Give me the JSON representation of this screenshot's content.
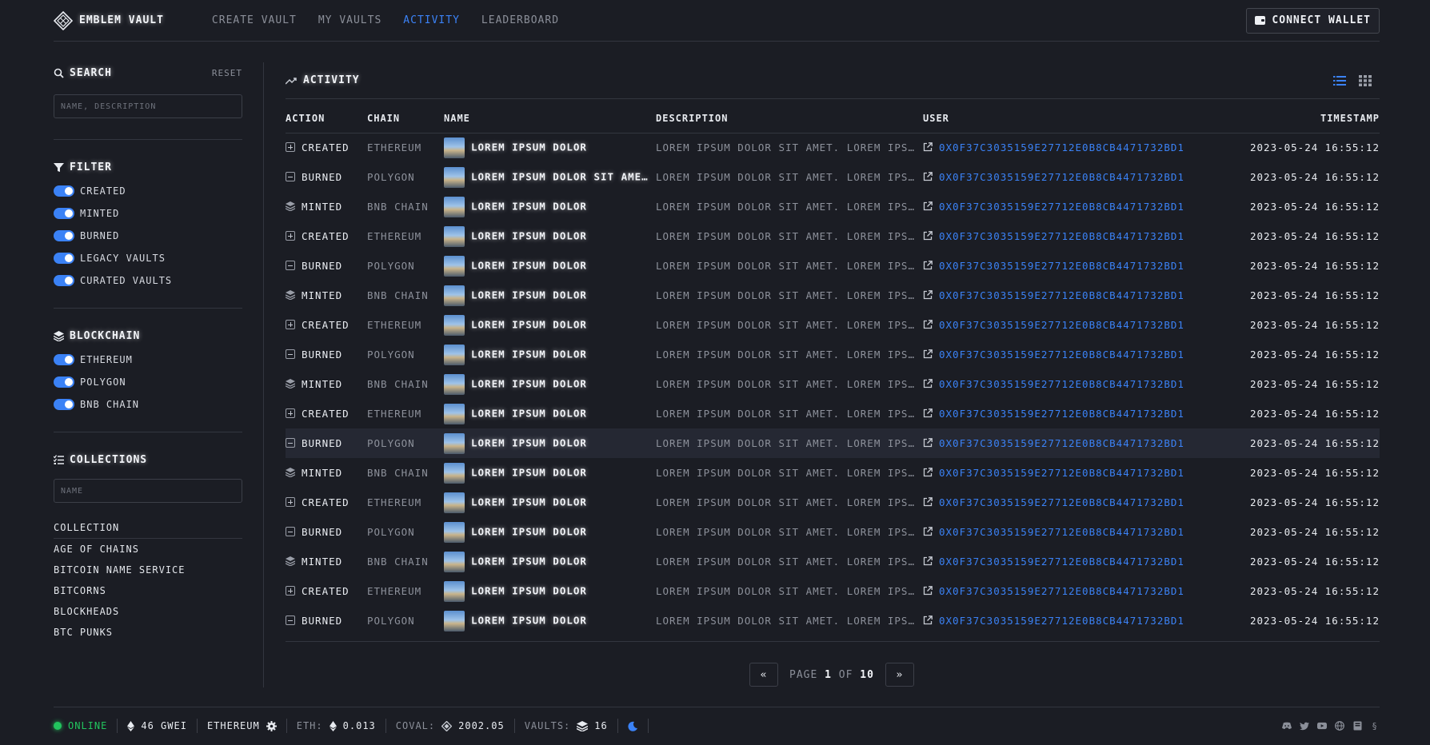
{
  "header": {
    "brand": "Emblem Vault",
    "nav": [
      {
        "label": "Create Vault",
        "active": false
      },
      {
        "label": "My Vaults",
        "active": false
      },
      {
        "label": "Activity",
        "active": true
      },
      {
        "label": "Leaderboard",
        "active": false
      }
    ],
    "connect_wallet": "Connect Wallet"
  },
  "sidebar": {
    "search": {
      "title": "Search",
      "reset": "Reset",
      "placeholder": "Name, Description"
    },
    "filter": {
      "title": "Filter",
      "items": [
        "Created",
        "Minted",
        "Burned",
        "Legacy Vaults",
        "Curated Vaults"
      ]
    },
    "blockchain": {
      "title": "Blockchain",
      "items": [
        "Ethereum",
        "Polygon",
        "BNB Chain"
      ]
    },
    "collections": {
      "title": "Collections",
      "placeholder": "Name",
      "header": "Collection",
      "items": [
        "Age of Chains",
        "Bitcoin Name Service",
        "Bitcorns",
        "Blockheads",
        "BTC Punks"
      ]
    }
  },
  "main": {
    "title": "Activity",
    "columns": [
      "Action",
      "Chain",
      "Name",
      "Description",
      "User",
      "Timestamp"
    ],
    "rows": [
      {
        "action": "Created",
        "chain": "Ethereum",
        "name": "Lorem ipsum dolor",
        "description": "Lorem ipsum dolor sit amet. Lorem ipsum dolor sit amet.",
        "user": "0x0F37C3035159E27712E0B8CB4471732BD1",
        "timestamp": "2023-05-24 16:55:12"
      },
      {
        "action": "Burned",
        "chain": "Polygon",
        "name": "Lorem ipsum dolor sit amet. Lorem ipsum",
        "description": "Lorem ipsum dolor sit amet. Lorem ipsum dolor sit amet.",
        "user": "0x0F37C3035159E27712E0B8CB4471732BD1",
        "timestamp": "2023-05-24 16:55:12"
      },
      {
        "action": "Minted",
        "chain": "BNB Chain",
        "name": "Lorem ipsum dolor",
        "description": "Lorem ipsum dolor sit amet. Lorem ipsum dolor sit amet.",
        "user": "0x0F37C3035159E27712E0B8CB4471732BD1",
        "timestamp": "2023-05-24 16:55:12"
      },
      {
        "action": "Created",
        "chain": "Ethereum",
        "name": "Lorem ipsum dolor",
        "description": "Lorem ipsum dolor sit amet. Lorem ipsum dolor sit amet.",
        "user": "0x0F37C3035159E27712E0B8CB4471732BD1",
        "timestamp": "2023-05-24 16:55:12"
      },
      {
        "action": "Burned",
        "chain": "Polygon",
        "name": "Lorem ipsum dolor",
        "description": "Lorem ipsum dolor sit amet. Lorem ipsum dolor sit amet.",
        "user": "0x0F37C3035159E27712E0B8CB4471732BD1",
        "timestamp": "2023-05-24 16:55:12"
      },
      {
        "action": "Minted",
        "chain": "BNB Chain",
        "name": "Lorem ipsum dolor",
        "description": "Lorem ipsum dolor sit amet. Lorem ipsum dolor sit amet.",
        "user": "0x0F37C3035159E27712E0B8CB4471732BD1",
        "timestamp": "2023-05-24 16:55:12"
      },
      {
        "action": "Created",
        "chain": "Ethereum",
        "name": "Lorem ipsum dolor",
        "description": "Lorem ipsum dolor sit amet. Lorem ipsum dolor sit amet.",
        "user": "0x0F37C3035159E27712E0B8CB4471732BD1",
        "timestamp": "2023-05-24 16:55:12"
      },
      {
        "action": "Burned",
        "chain": "Polygon",
        "name": "Lorem ipsum dolor",
        "description": "Lorem ipsum dolor sit amet. Lorem ipsum dolor sit amet.",
        "user": "0x0F37C3035159E27712E0B8CB4471732BD1",
        "timestamp": "2023-05-24 16:55:12"
      },
      {
        "action": "Minted",
        "chain": "BNB Chain",
        "name": "Lorem ipsum dolor",
        "description": "Lorem ipsum dolor sit amet. Lorem ipsum dolor sit amet.",
        "user": "0x0F37C3035159E27712E0B8CB4471732BD1",
        "timestamp": "2023-05-24 16:55:12"
      },
      {
        "action": "Created",
        "chain": "Ethereum",
        "name": "Lorem ipsum dolor",
        "description": "Lorem ipsum dolor sit amet. Lorem ipsum dolor sit amet.",
        "user": "0x0F37C3035159E27712E0B8CB4471732BD1",
        "timestamp": "2023-05-24 16:55:12"
      },
      {
        "action": "Burned",
        "chain": "Polygon",
        "name": "Lorem ipsum dolor",
        "description": "Lorem ipsum dolor sit amet. Lorem ipsum dolor sit amet.",
        "user": "0x0F37C3035159E27712E0B8CB4471732BD1",
        "timestamp": "2023-05-24 16:55:12",
        "highlighted": true
      },
      {
        "action": "Minted",
        "chain": "BNB Chain",
        "name": "Lorem ipsum dolor",
        "description": "Lorem ipsum dolor sit amet. Lorem ipsum dolor sit amet.",
        "user": "0x0F37C3035159E27712E0B8CB4471732BD1",
        "timestamp": "2023-05-24 16:55:12"
      },
      {
        "action": "Created",
        "chain": "Ethereum",
        "name": "Lorem ipsum dolor",
        "description": "Lorem ipsum dolor sit amet. Lorem ipsum dolor sit amet.",
        "user": "0x0F37C3035159E27712E0B8CB4471732BD1",
        "timestamp": "2023-05-24 16:55:12"
      },
      {
        "action": "Burned",
        "chain": "Polygon",
        "name": "Lorem ipsum dolor",
        "description": "Lorem ipsum dolor sit amet. Lorem ipsum dolor sit amet.",
        "user": "0x0F37C3035159E27712E0B8CB4471732BD1",
        "timestamp": "2023-05-24 16:55:12"
      },
      {
        "action": "Minted",
        "chain": "BNB Chain",
        "name": "Lorem ipsum dolor",
        "description": "Lorem ipsum dolor sit amet. Lorem ipsum dolor sit amet.",
        "user": "0x0F37C3035159E27712E0B8CB4471732BD1",
        "timestamp": "2023-05-24 16:55:12"
      },
      {
        "action": "Created",
        "chain": "Ethereum",
        "name": "Lorem ipsum dolor",
        "description": "Lorem ipsum dolor sit amet. Lorem ipsum dolor sit amet.",
        "user": "0x0F37C3035159E27712E0B8CB4471732BD1",
        "timestamp": "2023-05-24 16:55:12"
      },
      {
        "action": "Burned",
        "chain": "Polygon",
        "name": "Lorem ipsum dolor",
        "description": "Lorem ipsum dolor sit amet. Lorem ipsum dolor sit amet.",
        "user": "0x0F37C3035159E27712E0B8CB4471732BD1",
        "timestamp": "2023-05-24 16:55:12"
      }
    ]
  },
  "pagination": {
    "prev": "«",
    "page_label": "Page",
    "current": "1",
    "of_label": "of",
    "total": "10",
    "next": "»"
  },
  "footer": {
    "status": "Online",
    "gas": "46 GWEI",
    "network": "Ethereum",
    "eth_label": "ETH:",
    "eth_value": "0.013",
    "coval_label": "COVAL:",
    "coval_value": "2002.05",
    "vaults_label": "Vaults:",
    "vaults_value": "16",
    "socials": [
      "discord-icon",
      "twitter-icon",
      "youtube-icon",
      "globe-icon",
      "book-icon",
      "section-icon"
    ]
  },
  "colors": {
    "accent": "#3b82f6",
    "online": "#22c55e",
    "background": "#1b1d24"
  }
}
